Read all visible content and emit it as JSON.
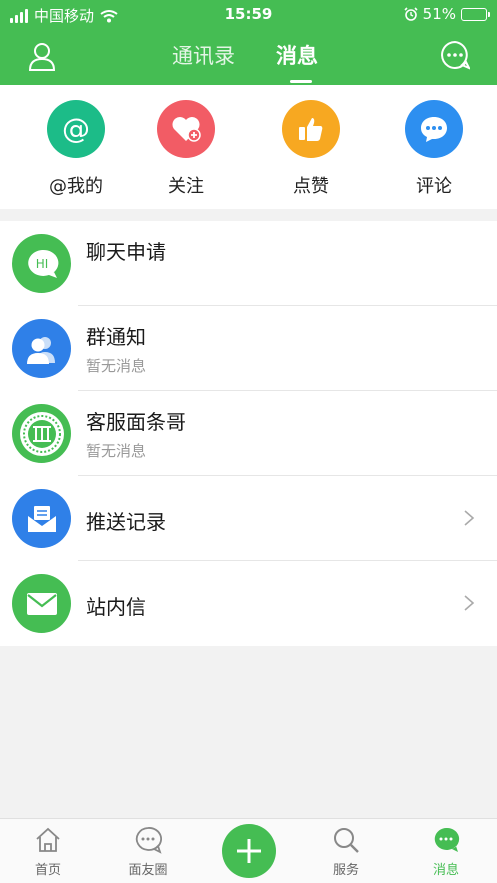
{
  "status_bar": {
    "carrier": "中国移动",
    "time": "15:59",
    "battery": "51%",
    "battery_level": 0.51
  },
  "nav": {
    "tabs": [
      {
        "label": "通讯录"
      },
      {
        "label": "消息"
      }
    ],
    "active_tab": 1
  },
  "quick_actions": [
    {
      "label": "@我的",
      "icon": "at-icon",
      "color": "#1cbc88"
    },
    {
      "label": "关注",
      "icon": "heart-plus-icon",
      "color": "#f25c65"
    },
    {
      "label": "点赞",
      "icon": "thumbs-up-icon",
      "color": "#f7a821"
    },
    {
      "label": "评论",
      "icon": "comment-icon",
      "color": "#2d8ff0"
    }
  ],
  "conversations": [
    {
      "title": "聊天申请",
      "subtitle": "",
      "avatar_text": "HI"
    },
    {
      "title": "群通知",
      "subtitle": "暂无消息"
    },
    {
      "title": "客服面条哥",
      "subtitle": "暂无消息"
    },
    {
      "title": "推送记录",
      "subtitle": ""
    },
    {
      "title": "站内信",
      "subtitle": ""
    }
  ],
  "tab_bar": {
    "items": [
      {
        "label": "首页"
      },
      {
        "label": "面友圈"
      },
      {
        "label": "服务"
      },
      {
        "label": "消息"
      }
    ],
    "active": 3
  },
  "colors": {
    "brand_green": "#45bd53",
    "blue": "#2f80e8",
    "text_gray": "#999999"
  }
}
